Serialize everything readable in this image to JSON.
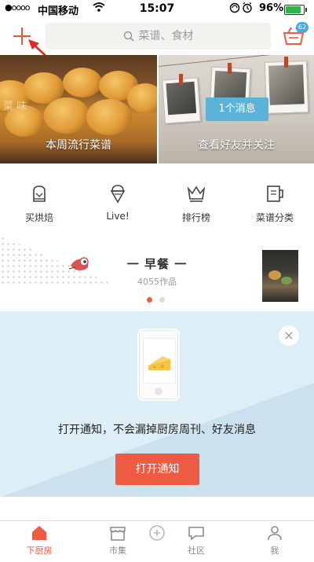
{
  "status_bar": {
    "signal": "●oooo",
    "carrier": "中国移动",
    "time": "15:07",
    "battery": "96%",
    "battery_level": 0.96
  },
  "top_bar": {
    "search_placeholder": "菜谱、食材",
    "cart_badge": "62"
  },
  "banners": [
    {
      "title": "本周流行菜谱",
      "overlay": "菜 味"
    },
    {
      "title": "查看好友并关注",
      "button": "1个消息"
    }
  ],
  "categories": [
    {
      "label": "买烘焙",
      "icon": "glove-icon"
    },
    {
      "label": "Live!",
      "icon": "ice-cream-icon"
    },
    {
      "label": "排行榜",
      "icon": "crown-icon"
    },
    {
      "label": "菜谱分类",
      "icon": "menu-card-icon"
    }
  ],
  "section": {
    "title": "一 早餐 一",
    "subtitle": "4055作品"
  },
  "notification": {
    "text": "打开通知，不会漏掉厨房周刊、好友消息",
    "button": "打开通知",
    "close": "×"
  },
  "tabs": [
    {
      "label": "下厨房",
      "icon": "house-icon",
      "active": true
    },
    {
      "label": "市集",
      "icon": "shop-icon",
      "active": false
    },
    {
      "label": "",
      "icon": "center-icon",
      "active": false
    },
    {
      "label": "社区",
      "icon": "chat-icon",
      "active": false
    },
    {
      "label": "我",
      "icon": "person-icon",
      "active": false
    }
  ],
  "colors": {
    "accent": "#ef5a43",
    "badge": "#48a9e0",
    "panel": "#ddeef7",
    "message_button": "#5ab3d9"
  }
}
